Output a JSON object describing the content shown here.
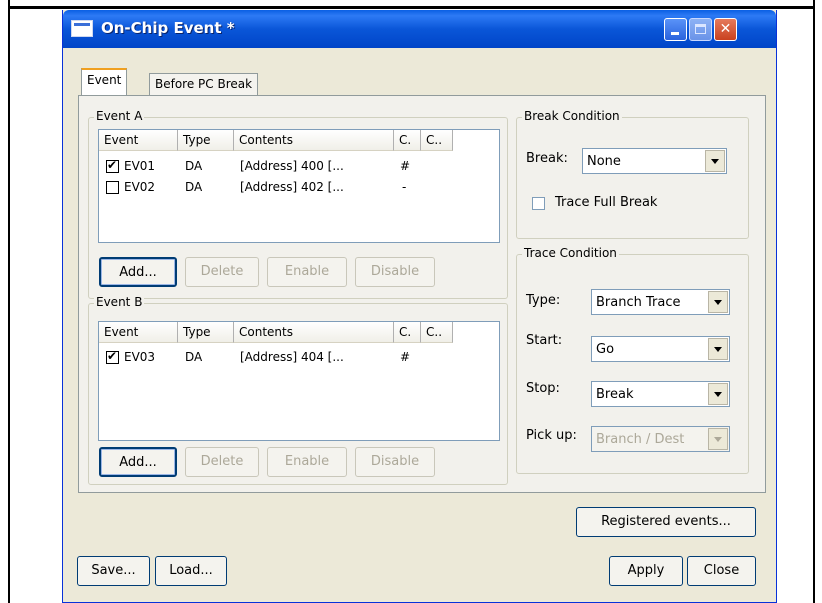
{
  "window": {
    "title": "On-Chip Event *"
  },
  "tabs": [
    {
      "label": "Event"
    },
    {
      "label": "Before PC Break"
    }
  ],
  "event_a": {
    "legend": "Event A",
    "columns": [
      "Event",
      "Type",
      "Contents",
      "C.",
      "C.."
    ],
    "rows": [
      {
        "checked": true,
        "event": "EV01",
        "type": "DA",
        "contents": "[Address] 400 [...",
        "c1": "#"
      },
      {
        "checked": false,
        "event": "EV02",
        "type": "DA",
        "contents": "[Address] 402 [...",
        "c1": "-"
      }
    ],
    "buttons": {
      "add": "Add...",
      "delete": "Delete",
      "enable": "Enable",
      "disable": "Disable"
    }
  },
  "event_b": {
    "legend": "Event B",
    "columns": [
      "Event",
      "Type",
      "Contents",
      "C.",
      "C.."
    ],
    "rows": [
      {
        "checked": true,
        "event": "EV03",
        "type": "DA",
        "contents": "[Address] 404 [...",
        "c1": "#"
      }
    ],
    "buttons": {
      "add": "Add...",
      "delete": "Delete",
      "enable": "Enable",
      "disable": "Disable"
    }
  },
  "break_condition": {
    "legend": "Break Condition",
    "break_label": "Break:",
    "break_value": "None",
    "trace_full_break_label": "Trace Full Break",
    "trace_full_break_checked": false
  },
  "trace_condition": {
    "legend": "Trace Condition",
    "type_label": "Type:",
    "type_value": "Branch Trace",
    "start_label": "Start:",
    "start_value": "Go",
    "stop_label": "Stop:",
    "stop_value": "Break",
    "pickup_label": "Pick up:",
    "pickup_value": "Branch / Dest"
  },
  "footer": {
    "registered_events": "Registered events...",
    "save": "Save...",
    "load": "Load...",
    "apply": "Apply",
    "close": "Close"
  },
  "colors": {
    "title_bar": "#0a56d8",
    "dialog_bg": "#ece9d8",
    "tab_accent": "#f0a020"
  },
  "icons": [
    "window-icon",
    "minimize-icon",
    "maximize-icon",
    "close-icon",
    "checkbox-icon",
    "dropdown-arrow-icon"
  ]
}
